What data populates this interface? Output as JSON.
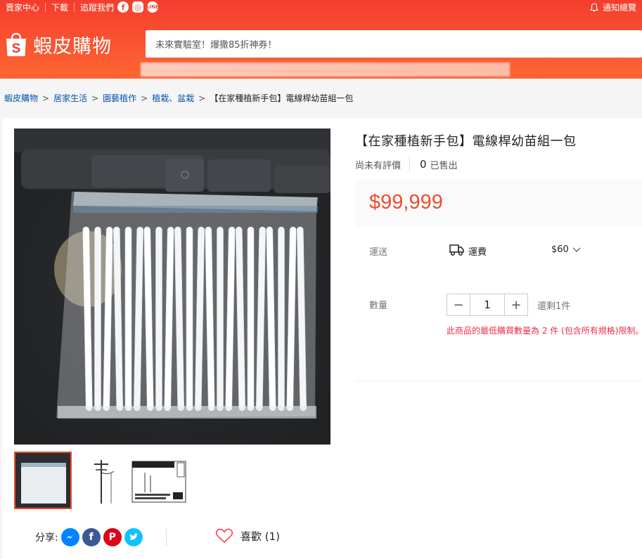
{
  "topbar": {
    "seller_center": "賣家中心",
    "download": "下載",
    "follow_us": "追蹤我們",
    "notifications": "通知總覽",
    "brand_color": "#f53d2d"
  },
  "logo": {
    "text": "蝦皮購物",
    "bag_letter": "S"
  },
  "search": {
    "placeholder": "未來實驗室！爆撒85折神券！"
  },
  "breadcrumb": {
    "items": [
      "蝦皮購物",
      "居家生活",
      "園藝植作",
      "植栽、盆栽"
    ],
    "current": "【在家種植新手包】電線桿幼苗組一包"
  },
  "product": {
    "title": "【在家種植新手包】電線桿幼苗組一包",
    "no_rating": "尚未有評價",
    "sold_count": "0",
    "sold_label": "已售出",
    "price": "$99,999",
    "price_color": "#ee4d2d"
  },
  "shipping": {
    "label": "運送",
    "method": "運費",
    "fee": "$60"
  },
  "quantity": {
    "label": "數量",
    "value": "1",
    "minus": "−",
    "plus": "+",
    "stock": "還剩1件",
    "warning": "此商品的最低購買數量為 2 件 (包含所有規格)限制。"
  },
  "share": {
    "label": "分享:"
  },
  "like": {
    "label": "喜歡 (1)"
  }
}
